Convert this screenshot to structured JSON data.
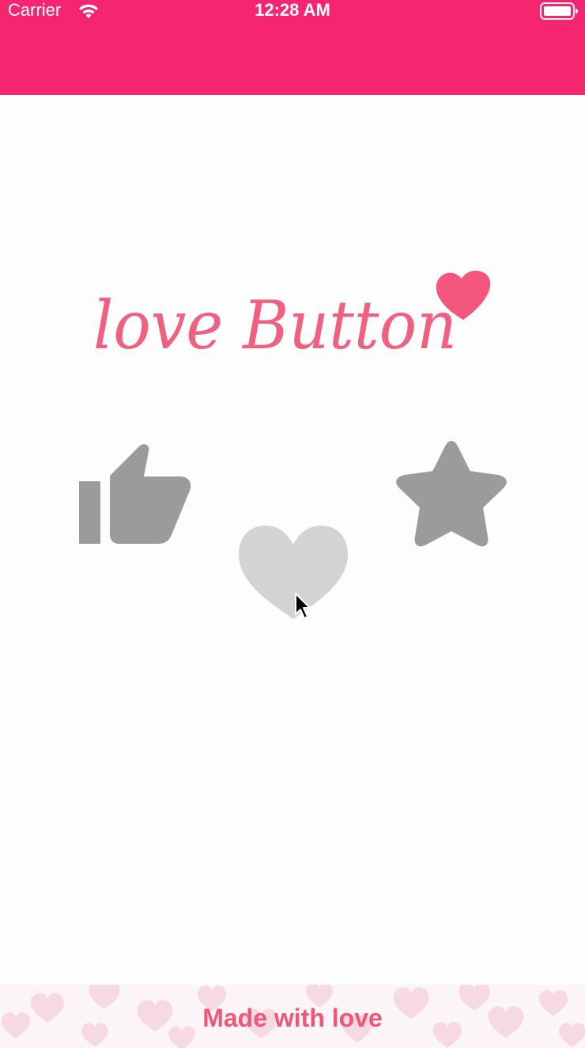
{
  "status_bar": {
    "carrier": "Carrier",
    "time": "12:28 AM",
    "wifi_icon": "wifi-icon",
    "battery_icon": "battery-icon"
  },
  "nav_bar": {
    "color": "#f5266f"
  },
  "logo": {
    "text": "love Button",
    "color": "#f06080",
    "icon": "heart-icon"
  },
  "buttons": [
    {
      "name": "thumbs-up",
      "icon": "thumbs-up-icon",
      "state": "inactive",
      "color": "#9b9b9b"
    },
    {
      "name": "heart",
      "icon": "heart-icon",
      "state": "pressed",
      "color": "#d3d3d3"
    },
    {
      "name": "star",
      "icon": "star-icon",
      "state": "inactive",
      "color": "#9b9b9b"
    }
  ],
  "footer": {
    "text": "Made with love",
    "color": "#f15679"
  }
}
